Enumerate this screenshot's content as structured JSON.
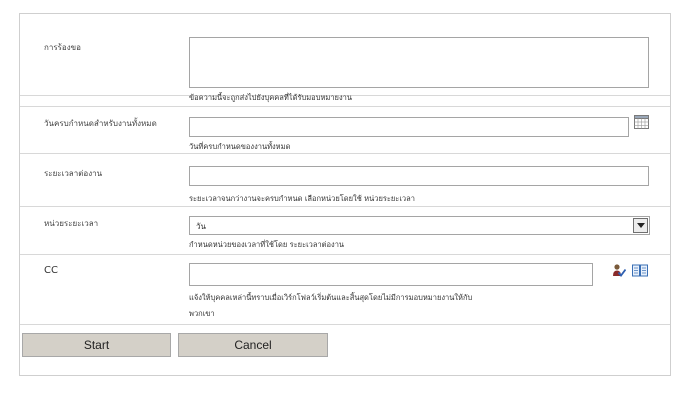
{
  "form": {
    "request": {
      "label": "การร้องขอ",
      "value": "",
      "hint": "ข้อความนี้จะถูกส่งไปยังบุคคลที่ได้รับมอบหมายงาน"
    },
    "due_date": {
      "label": "วันครบกำหนดสำหรับงานทั้งหมด",
      "value": "",
      "hint": "วันที่ครบกำหนดของงานทั้งหมด",
      "icon": "calendar-icon"
    },
    "duration": {
      "label": "ระยะเวลาต่องาน",
      "value": "",
      "hint": "ระยะเวลาจนกว่างานจะครบกำหนด เลือกหน่วยโดยใช้ หน่วยระยะเวลา"
    },
    "duration_unit": {
      "label": "หน่วยระยะเวลา",
      "selected": "วัน",
      "hint": "กำหนดหน่วยของเวลาที่ใช้โดย ระยะเวลาต่องาน"
    },
    "cc": {
      "label": "CC",
      "value": "",
      "hint_line1": "แจ้งให้บุคคลเหล่านี้ทราบเมื่อเวิร์กโฟลว์เริ่มต้นและสิ้นสุดโดยไม่มีการมอบหมายงานให้กับ",
      "hint_line2": "พวกเขา",
      "icons": [
        "check-names-icon",
        "address-book-icon"
      ]
    }
  },
  "buttons": {
    "start": "Start",
    "cancel": "Cancel"
  }
}
